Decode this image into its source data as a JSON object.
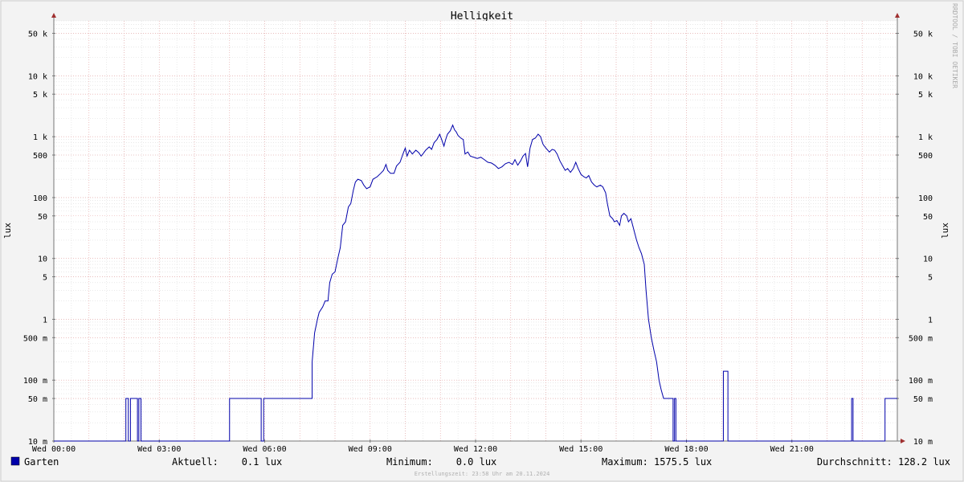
{
  "chart_data": {
    "type": "line",
    "title": "Helligkeit",
    "ylabel_left": "lux",
    "ylabel_right": "lux",
    "watermark": "RRDTOOL / TOBI OETIKER",
    "y_scale": "log",
    "ylim": [
      0.01,
      80000
    ],
    "xlim_hours": [
      0,
      24
    ],
    "x_ticks": [
      {
        "hour": 0,
        "label": "Wed 00:00"
      },
      {
        "hour": 3,
        "label": "Wed 03:00"
      },
      {
        "hour": 6,
        "label": "Wed 06:00"
      },
      {
        "hour": 9,
        "label": "Wed 09:00"
      },
      {
        "hour": 12,
        "label": "Wed 12:00"
      },
      {
        "hour": 15,
        "label": "Wed 15:00"
      },
      {
        "hour": 18,
        "label": "Wed 18:00"
      },
      {
        "hour": 21,
        "label": "Wed 21:00"
      }
    ],
    "y_ticks": [
      {
        "value": 0.01,
        "label": "10 m"
      },
      {
        "value": 0.05,
        "label": "50 m"
      },
      {
        "value": 0.1,
        "label": "100 m"
      },
      {
        "value": 0.5,
        "label": "500 m"
      },
      {
        "value": 1,
        "label": "1"
      },
      {
        "value": 5,
        "label": "5"
      },
      {
        "value": 10,
        "label": "10"
      },
      {
        "value": 50,
        "label": "50"
      },
      {
        "value": 100,
        "label": "100"
      },
      {
        "value": 500,
        "label": "500"
      },
      {
        "value": 1000,
        "label": "1 k"
      },
      {
        "value": 5000,
        "label": "5 k"
      },
      {
        "value": 10000,
        "label": "10 k"
      },
      {
        "value": 50000,
        "label": "50 k"
      }
    ],
    "series": [
      {
        "name": "Garten",
        "color": "#0000aa",
        "points": [
          [
            0.0,
            0.01
          ],
          [
            2.05,
            0.01
          ],
          [
            2.05,
            0.05
          ],
          [
            2.12,
            0.05
          ],
          [
            2.12,
            0.01
          ],
          [
            2.18,
            0.01
          ],
          [
            2.18,
            0.05
          ],
          [
            2.38,
            0.05
          ],
          [
            2.38,
            0.01
          ],
          [
            2.42,
            0.01
          ],
          [
            2.42,
            0.05
          ],
          [
            2.48,
            0.05
          ],
          [
            2.48,
            0.01
          ],
          [
            5.0,
            0.01
          ],
          [
            5.0,
            0.05
          ],
          [
            5.9,
            0.05
          ],
          [
            5.9,
            0.01
          ],
          [
            5.97,
            0.01
          ],
          [
            5.97,
            0.05
          ],
          [
            7.35,
            0.05
          ],
          [
            7.35,
            0.2
          ],
          [
            7.42,
            0.6
          ],
          [
            7.5,
            1.0
          ],
          [
            7.55,
            1.3
          ],
          [
            7.65,
            1.6
          ],
          [
            7.72,
            2.0
          ],
          [
            7.8,
            2.0
          ],
          [
            7.85,
            4.0
          ],
          [
            7.92,
            5.5
          ],
          [
            8.0,
            6.0
          ],
          [
            8.08,
            10.0
          ],
          [
            8.15,
            15.0
          ],
          [
            8.22,
            35.0
          ],
          [
            8.3,
            40.0
          ],
          [
            8.38,
            70.0
          ],
          [
            8.45,
            80.0
          ],
          [
            8.52,
            130.0
          ],
          [
            8.58,
            180.0
          ],
          [
            8.65,
            200.0
          ],
          [
            8.75,
            190.0
          ],
          [
            8.82,
            160.0
          ],
          [
            8.9,
            140.0
          ],
          [
            9.0,
            150.0
          ],
          [
            9.08,
            200.0
          ],
          [
            9.2,
            220.0
          ],
          [
            9.3,
            250.0
          ],
          [
            9.38,
            280.0
          ],
          [
            9.45,
            350.0
          ],
          [
            9.5,
            280.0
          ],
          [
            9.58,
            250.0
          ],
          [
            9.68,
            250.0
          ],
          [
            9.75,
            330.0
          ],
          [
            9.85,
            380.0
          ],
          [
            9.95,
            550.0
          ],
          [
            10.0,
            650.0
          ],
          [
            10.05,
            480.0
          ],
          [
            10.12,
            600.0
          ],
          [
            10.2,
            520.0
          ],
          [
            10.3,
            600.0
          ],
          [
            10.38,
            550.0
          ],
          [
            10.45,
            480.0
          ],
          [
            10.5,
            520.0
          ],
          [
            10.58,
            600.0
          ],
          [
            10.68,
            680.0
          ],
          [
            10.75,
            620.0
          ],
          [
            10.82,
            800.0
          ],
          [
            10.9,
            900.0
          ],
          [
            10.98,
            1100.0
          ],
          [
            11.05,
            850.0
          ],
          [
            11.1,
            700.0
          ],
          [
            11.15,
            900.0
          ],
          [
            11.2,
            1100.0
          ],
          [
            11.28,
            1250.0
          ],
          [
            11.35,
            1550.0
          ],
          [
            11.4,
            1300.0
          ],
          [
            11.45,
            1200.0
          ],
          [
            11.5,
            1050.0
          ],
          [
            11.58,
            950.0
          ],
          [
            11.65,
            900.0
          ],
          [
            11.7,
            520.0
          ],
          [
            11.78,
            560.0
          ],
          [
            11.85,
            480.0
          ],
          [
            11.95,
            460.0
          ],
          [
            12.05,
            440.0
          ],
          [
            12.15,
            460.0
          ],
          [
            12.25,
            420.0
          ],
          [
            12.35,
            380.0
          ],
          [
            12.45,
            370.0
          ],
          [
            12.55,
            340.0
          ],
          [
            12.65,
            300.0
          ],
          [
            12.75,
            320.0
          ],
          [
            12.85,
            360.0
          ],
          [
            12.95,
            380.0
          ],
          [
            13.05,
            350.0
          ],
          [
            13.12,
            420.0
          ],
          [
            13.2,
            340.0
          ],
          [
            13.28,
            400.0
          ],
          [
            13.35,
            480.0
          ],
          [
            13.42,
            530.0
          ],
          [
            13.48,
            320.0
          ],
          [
            13.55,
            650.0
          ],
          [
            13.62,
            900.0
          ],
          [
            13.7,
            950.0
          ],
          [
            13.78,
            1100.0
          ],
          [
            13.85,
            1000.0
          ],
          [
            13.92,
            750.0
          ],
          [
            14.0,
            650.0
          ],
          [
            14.1,
            560.0
          ],
          [
            14.18,
            620.0
          ],
          [
            14.25,
            600.0
          ],
          [
            14.32,
            520.0
          ],
          [
            14.4,
            400.0
          ],
          [
            14.48,
            330.0
          ],
          [
            14.55,
            280.0
          ],
          [
            14.62,
            300.0
          ],
          [
            14.7,
            260.0
          ],
          [
            14.78,
            300.0
          ],
          [
            14.85,
            380.0
          ],
          [
            14.92,
            300.0
          ],
          [
            15.0,
            240.0
          ],
          [
            15.08,
            220.0
          ],
          [
            15.15,
            210.0
          ],
          [
            15.22,
            230.0
          ],
          [
            15.3,
            180.0
          ],
          [
            15.38,
            160.0
          ],
          [
            15.45,
            150.0
          ],
          [
            15.55,
            160.0
          ],
          [
            15.62,
            150.0
          ],
          [
            15.7,
            120.0
          ],
          [
            15.75,
            80.0
          ],
          [
            15.82,
            50.0
          ],
          [
            15.9,
            45.0
          ],
          [
            15.95,
            40.0
          ],
          [
            16.02,
            42.0
          ],
          [
            16.1,
            35.0
          ],
          [
            16.15,
            50.0
          ],
          [
            16.22,
            55.0
          ],
          [
            16.3,
            50.0
          ],
          [
            16.35,
            40.0
          ],
          [
            16.42,
            45.0
          ],
          [
            16.5,
            30.0
          ],
          [
            16.58,
            20.0
          ],
          [
            16.65,
            15.0
          ],
          [
            16.72,
            12.0
          ],
          [
            16.8,
            8.0
          ],
          [
            16.85,
            3.0
          ],
          [
            16.92,
            1.0
          ],
          [
            17.0,
            0.5
          ],
          [
            17.08,
            0.3
          ],
          [
            17.15,
            0.2
          ],
          [
            17.22,
            0.1
          ],
          [
            17.28,
            0.07
          ],
          [
            17.35,
            0.05
          ],
          [
            17.45,
            0.05
          ],
          [
            17.62,
            0.05
          ],
          [
            17.62,
            0.01
          ],
          [
            17.66,
            0.01
          ],
          [
            17.66,
            0.05
          ],
          [
            17.7,
            0.05
          ],
          [
            17.7,
            0.01
          ],
          [
            19.05,
            0.01
          ],
          [
            19.05,
            0.14
          ],
          [
            19.18,
            0.14
          ],
          [
            19.18,
            0.01
          ],
          [
            22.7,
            0.01
          ],
          [
            22.7,
            0.05
          ],
          [
            22.74,
            0.05
          ],
          [
            22.74,
            0.01
          ],
          [
            23.65,
            0.01
          ],
          [
            23.65,
            0.05
          ],
          [
            24.0,
            0.05
          ]
        ]
      }
    ]
  },
  "legend": {
    "series_name": "Garten",
    "swatch_color": "#0000aa",
    "current": "Aktuell:    0.1 lux",
    "minimum": "Minimum:    0.0 lux",
    "maximum": "Maximum: 1575.5 lux",
    "average": "Durchschnitt: 128.2 lux"
  },
  "footer": "Erstellungszeit: 23:58 Uhr am 20.11.2024"
}
